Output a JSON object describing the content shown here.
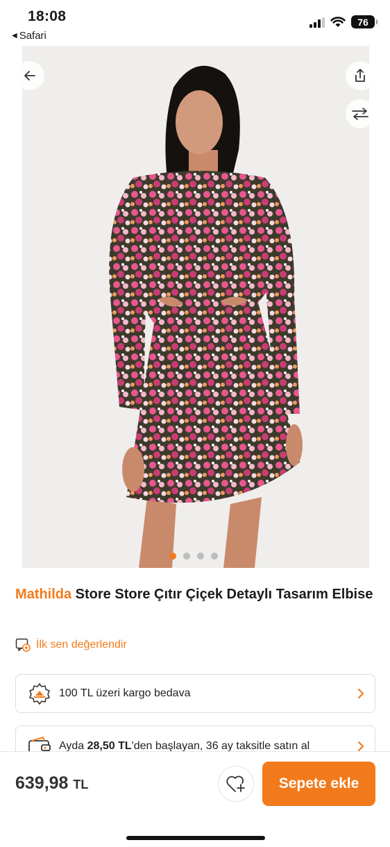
{
  "status_bar": {
    "time": "18:08",
    "back_app": "Safari",
    "battery": "76"
  },
  "colors": {
    "accent": "#f27a1a",
    "text": "#1b1b1b",
    "border": "#dcdcdc"
  },
  "gallery": {
    "image_count": 4,
    "active_index": 0
  },
  "product": {
    "brand": "Mathilda",
    "name": " Store Store Çıtır Çiçek Detaylı Tasarım Elbise",
    "review_link": "İlk sen değerlendir"
  },
  "shipping": {
    "text": "100 TL üzeri kargo bedava"
  },
  "installment": {
    "prefix": "Ayda ",
    "amount": "28,50 TL",
    "suffix": "'den başlayan, 36 ay taksitle satın al"
  },
  "bottom_bar": {
    "price": "639,98",
    "currency": "TL",
    "add_to_cart": "Sepete ekle"
  },
  "icons": {
    "back": "arrow-left-icon",
    "share": "share-icon",
    "compare": "compare-arrows-icon",
    "review": "review-edit-icon",
    "shipping": "free-shipping-badge-icon",
    "installment": "wallet-icon",
    "favorite": "heart-add-icon"
  }
}
